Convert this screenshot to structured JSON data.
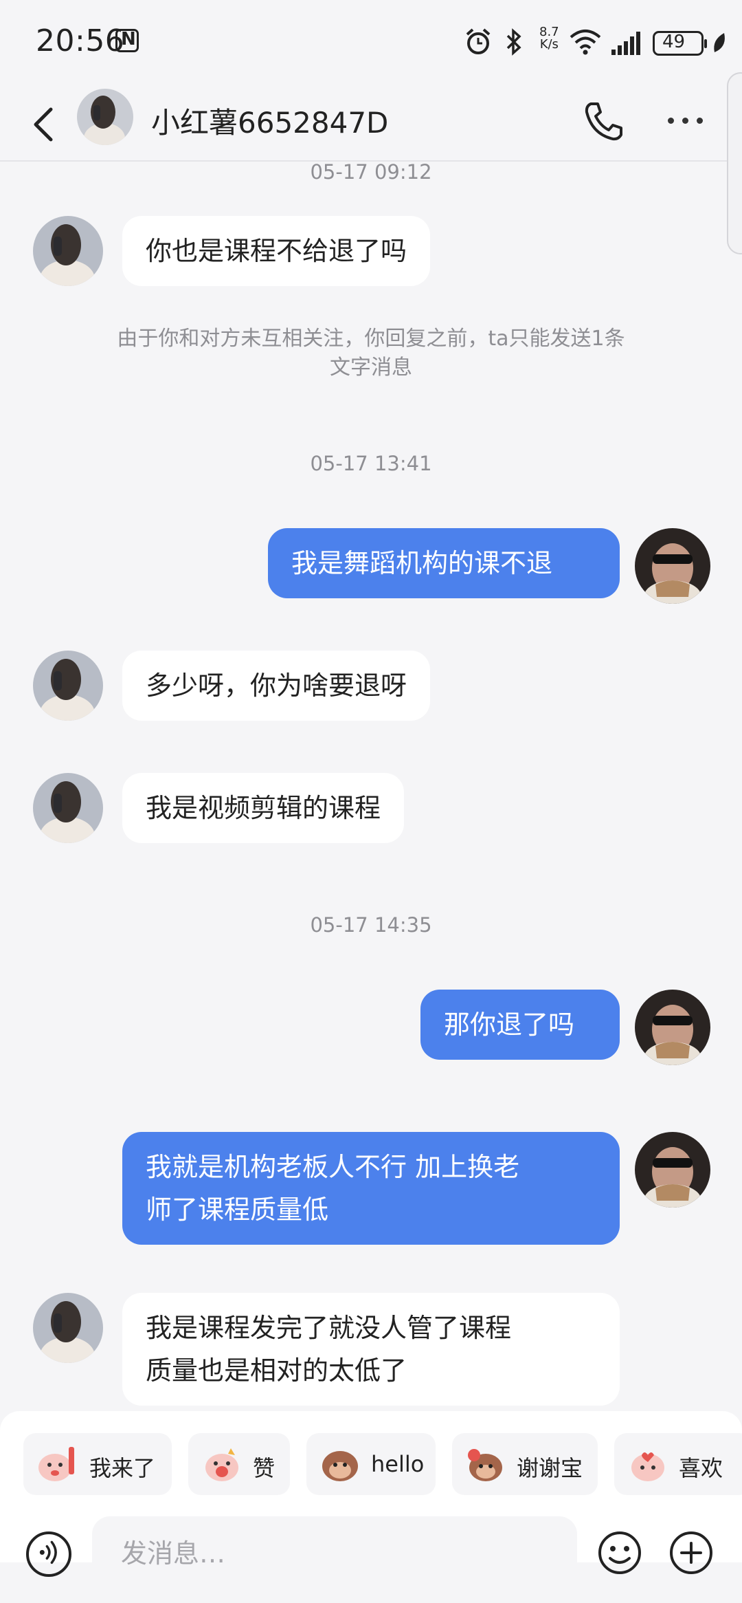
{
  "status_bar": {
    "time": "20:56",
    "net_speed_value": "8.7",
    "net_speed_unit": "K/s",
    "battery": "49"
  },
  "header": {
    "title": "小红薯6652847D"
  },
  "messages": {
    "ts1": "05-17 09:12",
    "m1": "你也是课程不给退了吗",
    "notice_line1": "由于你和对方未互相关注，你回复之前，ta只能发送1条",
    "notice_line2": "文字消息",
    "ts2": "05-17 13:41",
    "m2": "我是舞蹈机构的课不退",
    "m3": "多少呀，你为啥要退呀",
    "m4": "我是视频剪辑的课程",
    "ts3": "05-17 14:35",
    "m5": "那你退了吗",
    "m6_line1": "我就是机构老板人不行 加上换老",
    "m6_line2": "师了课程质量低",
    "m7_line1": "我是课程发完了就没人管了课程",
    "m7_line2": "质量也是相对的太低了"
  },
  "quick_replies": {
    "r1": "我来了",
    "r2": "赞",
    "r3": "hello",
    "r4": "谢谢宝",
    "r5": "喜欢"
  },
  "composer": {
    "placeholder": "发消息…"
  },
  "colors": {
    "outgoing_bubble": "#4c81ec",
    "incoming_bubble": "#ffffff",
    "background": "#f5f5f7"
  }
}
